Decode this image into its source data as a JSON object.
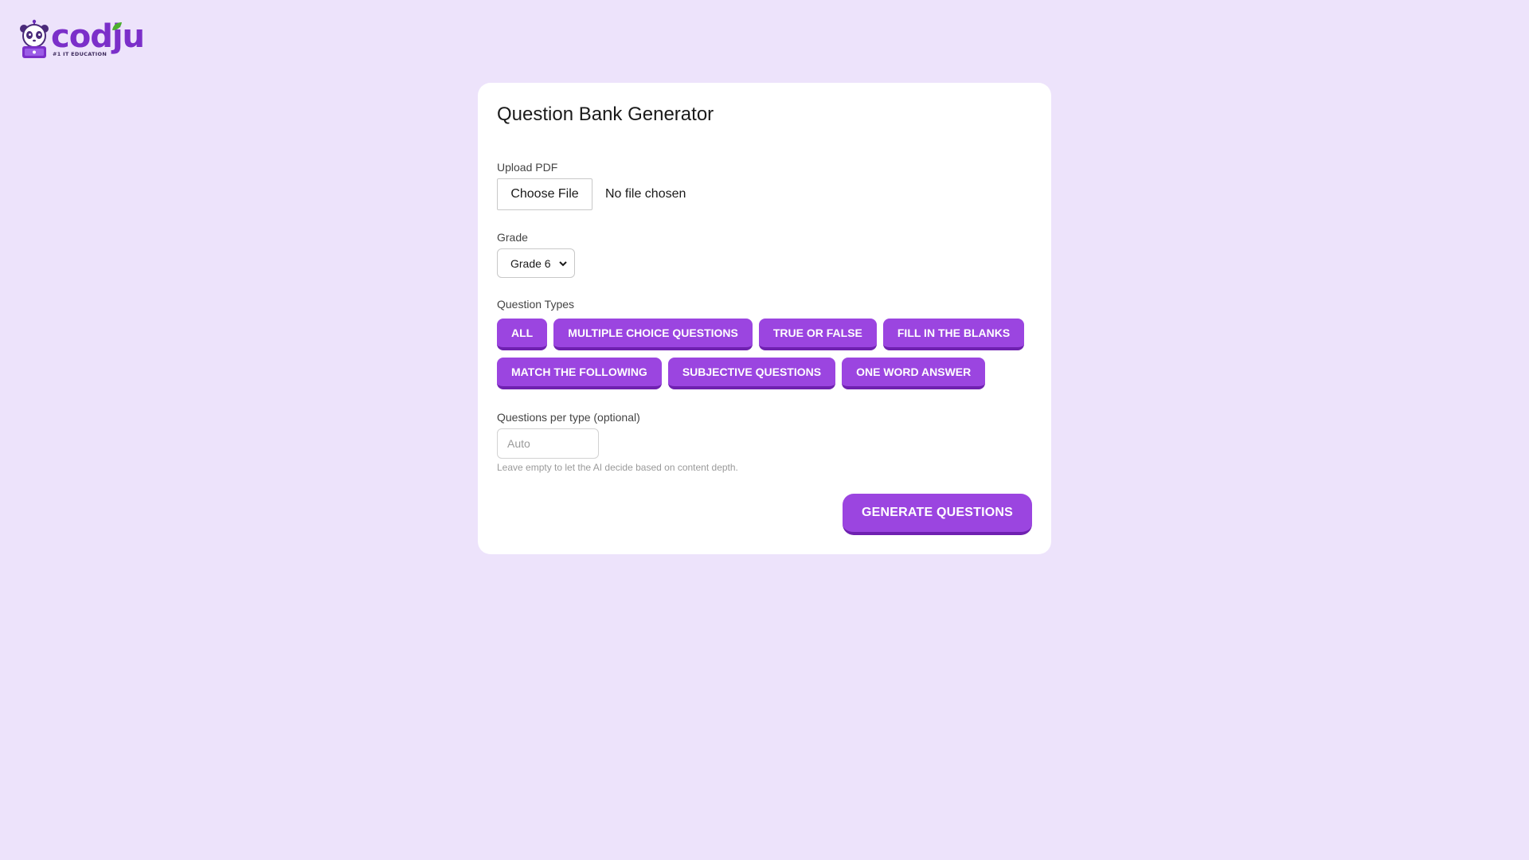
{
  "brand": {
    "logo_word": "codju",
    "logo_tagline": "#1 IT EDUCATION",
    "accent_color": "#7b2fc9",
    "mascot_icon": "panda-mascot-icon"
  },
  "form": {
    "title": "Question Bank Generator",
    "upload": {
      "label": "Upload PDF",
      "button_label": "Choose File",
      "status": "No file chosen"
    },
    "grade": {
      "label": "Grade",
      "selected": "Grade 6"
    },
    "question_types": {
      "label": "Question Types",
      "options": [
        "ALL",
        "MULTIPLE CHOICE QUESTIONS",
        "TRUE OR FALSE",
        "FILL IN THE BLANKS",
        "MATCH THE FOLLOWING",
        "SUBJECTIVE QUESTIONS",
        "ONE WORD ANSWER"
      ]
    },
    "per_type": {
      "label": "Questions per type (optional)",
      "value": "",
      "placeholder": "Auto",
      "hint": "Leave empty to let the AI decide based on content depth."
    },
    "submit_label": "GENERATE QUESTIONS"
  },
  "colors": {
    "page_background": "#ede3fb",
    "card_background": "#ffffff",
    "button_purple": "#9b45e0",
    "button_shadow": "#6f21b0"
  }
}
